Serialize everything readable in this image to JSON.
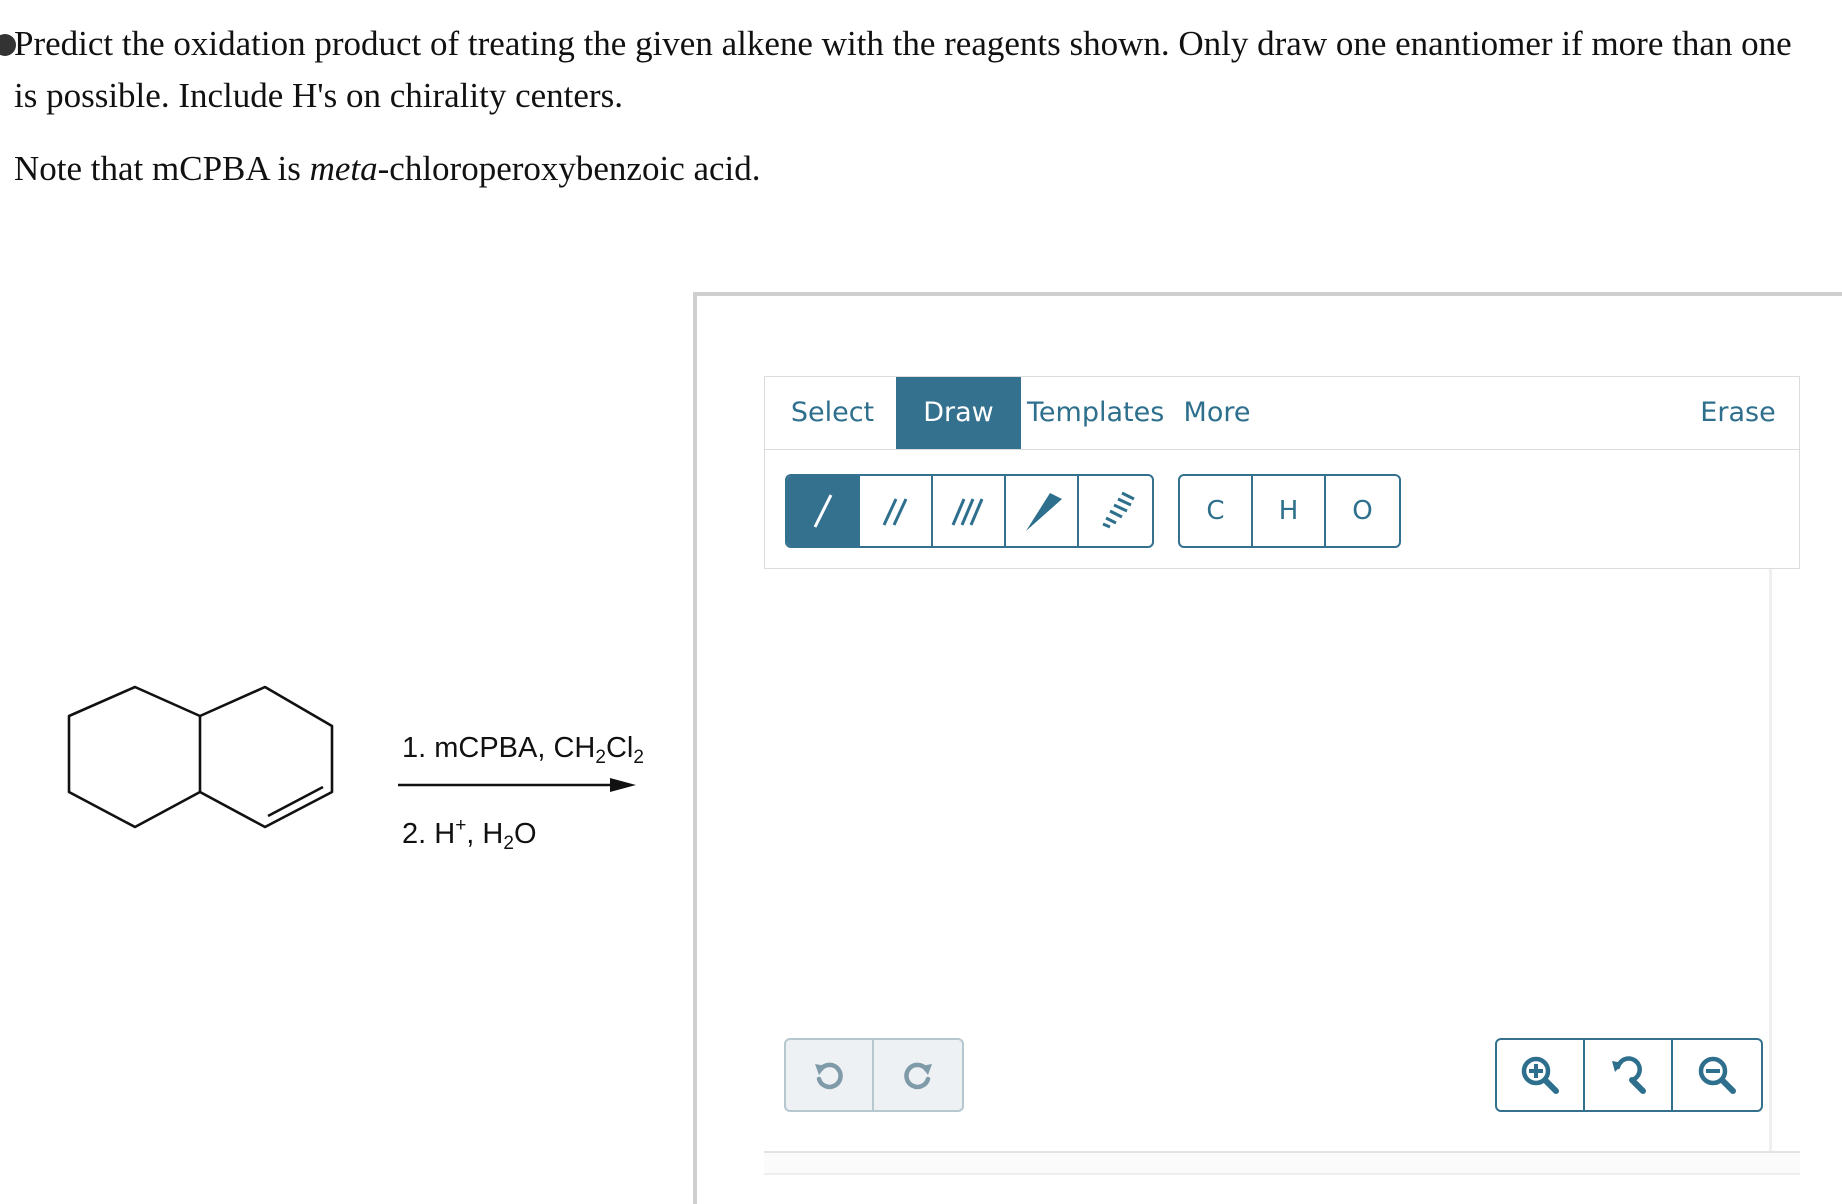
{
  "question": {
    "line1": "Predict the oxidation product of treating the given alkene with the reagents shown. Only draw one enantiomer if more than one",
    "line2": "is possible. Include H's on chirality centers.",
    "note_prefix": "Note that mCPBA is ",
    "note_italic": "meta",
    "note_suffix": "-chloroperoxybenzoic acid."
  },
  "reaction": {
    "step1_prefix": "1. mCPBA, CH",
    "step1_sub1": "2",
    "step1_mid": "Cl",
    "step1_sub2": "2",
    "step2_prefix": "2. H",
    "step2_sup": "+",
    "step2_mid": ", H",
    "step2_sub": "2",
    "step2_suffix": "O"
  },
  "editor": {
    "tabs": [
      "Select",
      "Draw",
      "Templates",
      "More"
    ],
    "active_tab": "Draw",
    "erase_label": "Erase",
    "bond_tools": [
      "single-bond",
      "double-bond",
      "triple-bond",
      "wedge-bond",
      "hash-bond"
    ],
    "active_bond_tool": "single-bond",
    "atoms": [
      "C",
      "H",
      "O"
    ],
    "history": [
      "undo",
      "redo"
    ],
    "zoom": [
      "zoom-in",
      "zoom-reset",
      "zoom-out"
    ]
  },
  "colors": {
    "accent": "#33718e",
    "accent_text": "#2d6f8c",
    "disabled_icon": "#7f9aa8"
  }
}
